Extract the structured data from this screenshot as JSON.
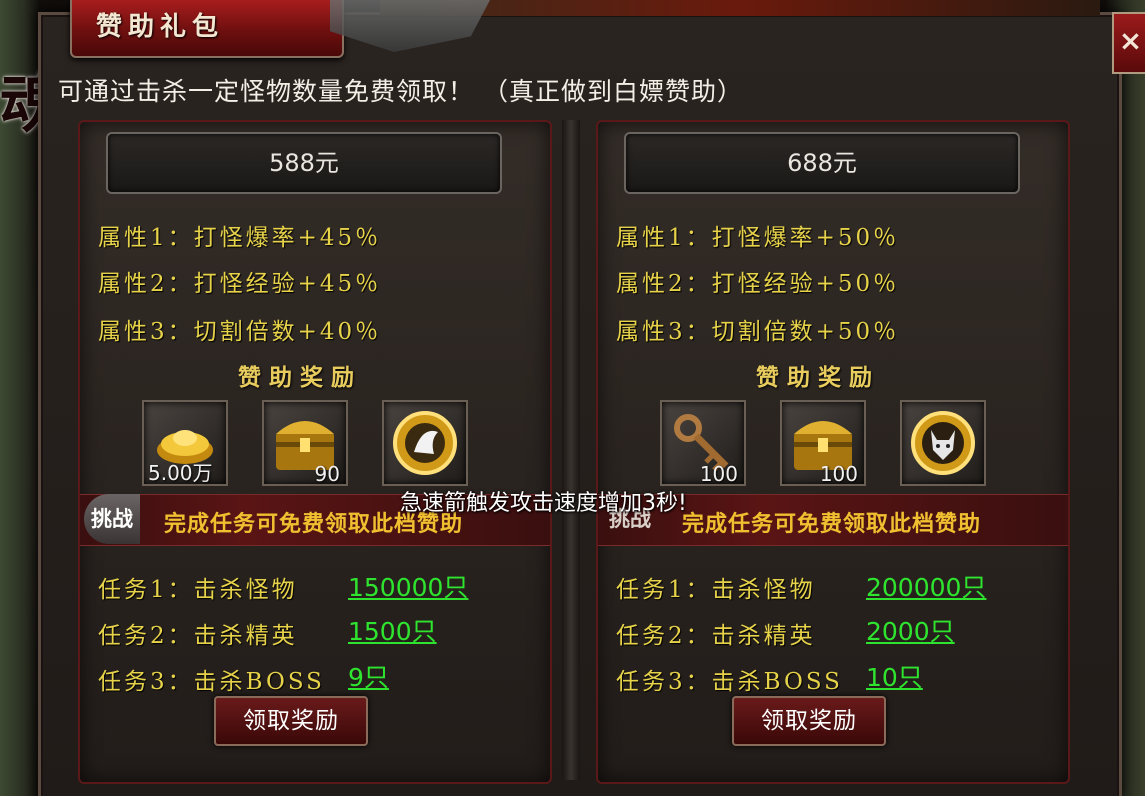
{
  "window": {
    "title": "赞助礼包",
    "close_glyph": "×",
    "subtitle": "可通过击杀一定怪物数量免费领取！ （真正做到白嫖赞助）",
    "bg_glyph": "魂"
  },
  "toast": "急速箭触发攻击速度增加3秒!",
  "tiers": [
    {
      "price": "588元",
      "attributes": [
        "属性1：打怪爆率+45％",
        "属性2：打怪经验+45％",
        "属性3：切割倍数+40％"
      ],
      "reward_title": "赞助奖励",
      "rewards": [
        {
          "icon": "gold-ingot-icon",
          "count": "5.00万"
        },
        {
          "icon": "treasure-chest-icon",
          "count": "90"
        },
        {
          "icon": "gold-medallion-icon",
          "count": ""
        }
      ],
      "challenge_badge": "挑战",
      "challenge_text": "完成任务可免费领取此档赞助",
      "tasks": [
        {
          "label": "任务1：击杀怪物",
          "value": "150000只"
        },
        {
          "label": "任务2：击杀精英",
          "value": "1500只"
        },
        {
          "label": "任务3：击杀BOSS",
          "value": "9只"
        }
      ],
      "claim_label": "领取奖励"
    },
    {
      "price": "688元",
      "attributes": [
        "属性1：打怪爆率+50％",
        "属性2：打怪经验+50％",
        "属性3：切割倍数+50％"
      ],
      "reward_title": "赞助奖励",
      "rewards": [
        {
          "icon": "key-icon",
          "count": "100"
        },
        {
          "icon": "treasure-chest-icon",
          "count": "100"
        },
        {
          "icon": "wolf-medallion-icon",
          "count": ""
        }
      ],
      "challenge_badge": "挑战",
      "challenge_text": "完成任务可免费领取此档赞助",
      "tasks": [
        {
          "label": "任务1：击杀怪物",
          "value": "200000只"
        },
        {
          "label": "任务2：击杀精英",
          "value": "2000只"
        },
        {
          "label": "任务3：击杀BOSS",
          "value": "10只"
        }
      ],
      "claim_label": "领取奖励"
    }
  ]
}
